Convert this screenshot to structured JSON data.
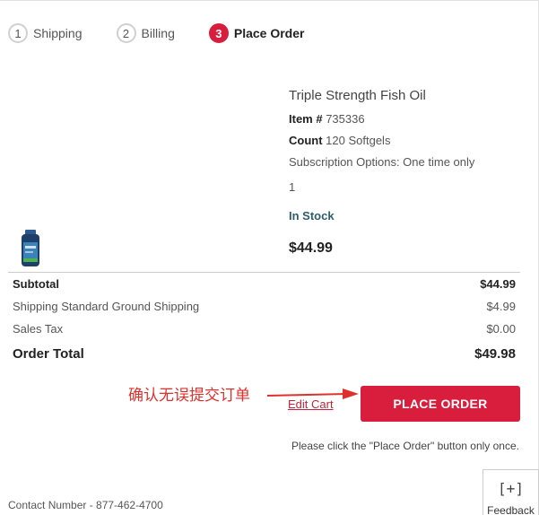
{
  "steps": [
    {
      "number": "1",
      "label": "Shipping"
    },
    {
      "number": "2",
      "label": "Billing"
    },
    {
      "number": "3",
      "label": "Place Order"
    }
  ],
  "product": {
    "name": "Triple Strength Fish Oil",
    "item_label": "Item #",
    "item_value": "735336",
    "count_label": "Count",
    "count_value": "120 Softgels",
    "subscription": "Subscription Options: One time only",
    "quantity": "1",
    "stock": "In Stock",
    "price": "$44.99"
  },
  "summary": {
    "subtotal_label": "Subtotal",
    "subtotal_value": "$44.99",
    "shipping_label": "Shipping Standard Ground Shipping",
    "shipping_value": "$4.99",
    "tax_label": "Sales Tax",
    "tax_value": "$0.00",
    "total_label": "Order Total",
    "total_value": "$49.98"
  },
  "annotation": {
    "text": "确认无误提交订单",
    "color": "#e0302d"
  },
  "actions": {
    "edit_cart": "Edit Cart",
    "place_order": "PLACE ORDER",
    "note": "Please click the \"Place Order\" button only once."
  },
  "contact": "Contact Number - 877-462-4700",
  "feedback": {
    "icon": "[+]",
    "label": "Feedback"
  },
  "colors": {
    "accent": "#d81e3c",
    "stock": "#2e5d6d"
  }
}
